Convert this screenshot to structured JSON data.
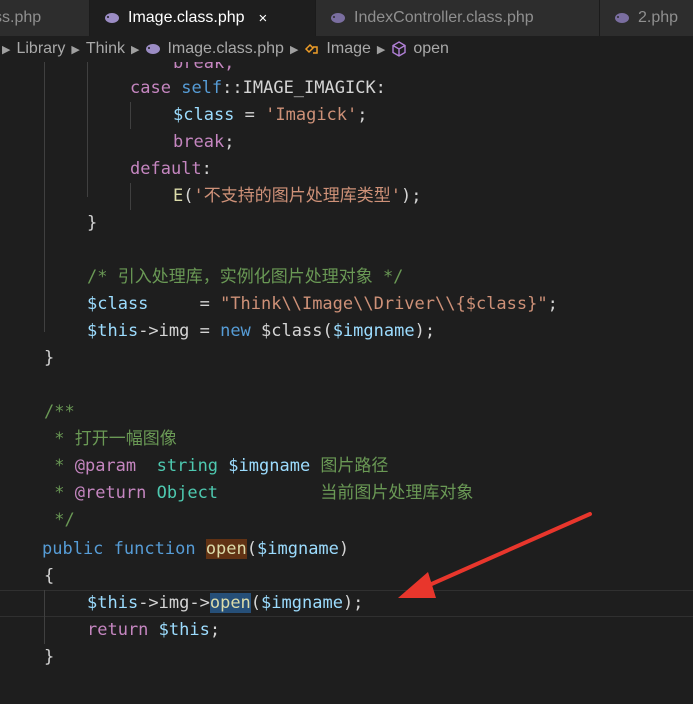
{
  "tabs": [
    {
      "label": "ss.php",
      "active": false
    },
    {
      "label": "Image.class.php",
      "active": true,
      "close": "×"
    },
    {
      "label": "IndexController.class.php",
      "active": false
    },
    {
      "label": "2.php",
      "active": false
    }
  ],
  "breadcrumb": [
    "Library",
    "Think",
    "Image.class.php",
    "Image",
    "open"
  ],
  "code": {
    "l0": "break;",
    "l1_case": "case",
    "l1_self": "self",
    "l1_const": "::IMAGE_IMAGICK:",
    "l2_var": "$class",
    "l2_eq": " = ",
    "l2_str": "'Imagick'",
    "l2_end": ";",
    "l3_break": "break",
    "l3_end": ";",
    "l4_default": "default",
    "l4_colon": ":",
    "l5_fn": "E",
    "l5_open": "(",
    "l5_str": "'不支持的图片处理库类型'",
    "l5_close": ");",
    "l6": "}",
    "l8_comment": "/* 引入处理库，实例化图片处理对象 */",
    "l9_var": "$class",
    "l9_eq": "     = ",
    "l9_str": "\"Think\\\\Image\\\\Driver\\\\{$class}\"",
    "l9_end": ";",
    "l10_this": "$this",
    "l10_arrow": "->img = ",
    "l10_new": "new",
    "l10_rest1": " $class(",
    "l10_arg": "$imgname",
    "l10_rest2": ");",
    "l11": "}",
    "l13": "/**",
    "l14": " * 打开一幅图像",
    "l15_a": " * ",
    "l15_tag": "@param",
    "l15_b": "  ",
    "l15_type": "string",
    "l15_c": " ",
    "l15_var": "$imgname",
    "l15_d": " 图片路径",
    "l16_a": " * ",
    "l16_tag": "@return",
    "l16_b": " ",
    "l16_type": "Object",
    "l16_d": "          当前图片处理库对象",
    "l17": " */",
    "l18_public": "public",
    "l18_function": "function",
    "l18_name": "open",
    "l18_open": "(",
    "l18_arg": "$imgname",
    "l18_close": ")",
    "l19": "{",
    "l20_this": "$this",
    "l20_arrow": "->img->",
    "l20_method": "open",
    "l20_open": "(",
    "l20_arg": "$imgname",
    "l20_close": ");",
    "l21_return": "return",
    "l21_sp": " ",
    "l21_this": "$this",
    "l21_end": ";",
    "l22": "}"
  },
  "colors": {
    "annotation_arrow": "#e8362c",
    "background": "#1e1e1e"
  },
  "icons": {
    "php_file_icon": "php-elephant-icon",
    "class_icon": "class-icon",
    "method_icon": "method-cube-icon"
  }
}
